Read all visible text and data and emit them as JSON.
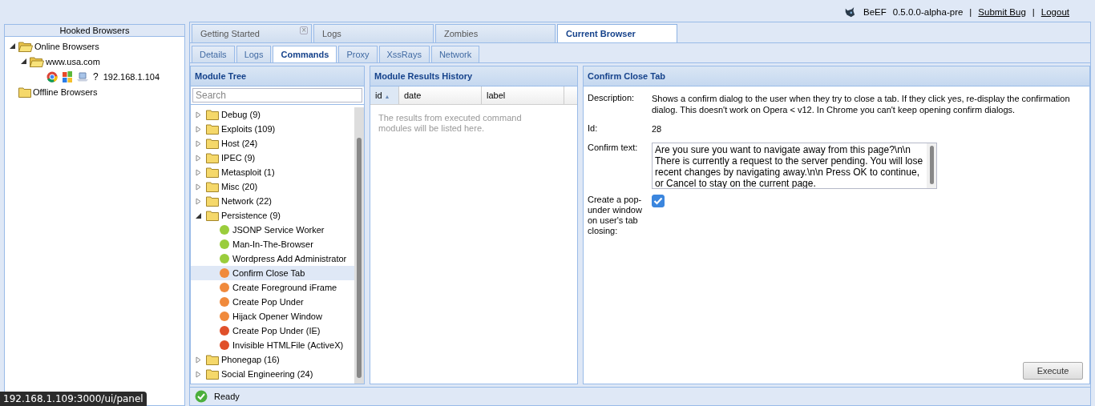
{
  "header": {
    "items": [
      {
        "kind": "text",
        "text": "BeEF"
      },
      {
        "kind": "text",
        "text": "0.5.0.0-alpha-pre"
      },
      {
        "kind": "sep",
        "text": "|"
      },
      {
        "kind": "link",
        "text": "Submit  Bug"
      },
      {
        "kind": "sep",
        "text": "|"
      },
      {
        "kind": "link",
        "text": "Logout"
      }
    ]
  },
  "hooked_browsers": {
    "title": "Hooked Browsers",
    "tree": [
      {
        "label": "Online Browsers",
        "expanded": true,
        "children": [
          {
            "label": "www.usa.com",
            "expanded": true,
            "children": [
              {
                "kind": "host",
                "label": "192.168.1.104",
                "os_unknown": "?"
              }
            ]
          }
        ]
      },
      {
        "label": "Offline Browsers",
        "expanded": false
      }
    ]
  },
  "main_tabs": [
    {
      "label": "Getting Started",
      "selected": false,
      "close_icon": "×"
    },
    {
      "label": "Logs",
      "selected": false
    },
    {
      "label": "Zombies",
      "selected": false
    },
    {
      "label": "Current Browser",
      "selected": true
    }
  ],
  "sub_tabs": [
    {
      "label": "Details",
      "selected": false
    },
    {
      "label": "Logs",
      "selected": false
    },
    {
      "label": "Commands",
      "selected": true
    },
    {
      "label": "Proxy",
      "selected": false
    },
    {
      "label": "XssRays",
      "selected": false
    },
    {
      "label": "Network",
      "selected": false
    }
  ],
  "module_tree": {
    "title": "Module Tree",
    "search": {
      "placeholder": "Search"
    },
    "items": [
      {
        "label": "Debug (9)",
        "expanded": false,
        "selected": false
      },
      {
        "label": "Exploits (109)",
        "expanded": false,
        "selected": false
      },
      {
        "label": "Host (24)",
        "expanded": false,
        "selected": false
      },
      {
        "label": "IPEC (9)",
        "expanded": false,
        "selected": false
      },
      {
        "label": "Metasploit (1)",
        "expanded": false,
        "selected": false
      },
      {
        "label": "Misc (20)",
        "expanded": false,
        "selected": false
      },
      {
        "label": "Network (22)",
        "expanded": false,
        "selected": false
      },
      {
        "label": "Persistence (9)",
        "expanded": true,
        "selected": false,
        "children": [
          {
            "label": "JSONP Service Worker",
            "color": "#9acd3c",
            "selected": false
          },
          {
            "label": "Man-In-The-Browser",
            "color": "#9acd3c",
            "selected": false
          },
          {
            "label": "Wordpress Add Administrator",
            "color": "#9acd3c",
            "selected": false
          },
          {
            "label": "Confirm Close Tab",
            "color": "#f08a3c",
            "selected": true
          },
          {
            "label": "Create Foreground iFrame",
            "color": "#f08a3c",
            "selected": false
          },
          {
            "label": "Create Pop Under",
            "color": "#f08a3c",
            "selected": false
          },
          {
            "label": "Hijack Opener Window",
            "color": "#f08a3c",
            "selected": false
          },
          {
            "label": "Create Pop Under (IE)",
            "color": "#e0502a",
            "selected": false
          },
          {
            "label": "Invisible HTMLFile (ActiveX)",
            "color": "#e0502a",
            "selected": false
          }
        ]
      },
      {
        "label": "Phonegap (16)",
        "expanded": false,
        "selected": false
      },
      {
        "label": "Social Engineering (24)",
        "expanded": false,
        "selected": false
      }
    ]
  },
  "results": {
    "title": "Module Results History",
    "columns": [
      {
        "label": "id",
        "sorted": true,
        "sort_icon": "▲"
      },
      {
        "label": "date",
        "sorted": false
      },
      {
        "label": "label",
        "sorted": false
      }
    ],
    "empty_text": "The results from executed command modules will be listed here."
  },
  "details": {
    "title": "Confirm Close Tab",
    "fields": [
      {
        "kind": "text",
        "label": "Description:",
        "value": "Shows a confirm dialog to the user when they try to close a tab. If they click yes, re-display the confirmation dialog. This doesn't work on Opera < v12. In Chrome you can't keep opening confirm dialogs."
      },
      {
        "kind": "text",
        "label": "Id:",
        "value": "28"
      },
      {
        "kind": "textarea",
        "label": "Confirm text:",
        "value": "Are you sure you want to navigate away from this page?\\n\\n There is currently a request to the server pending. You will lose recent changes by navigating away.\\n\\n Press OK to continue, or Cancel to stay on the current page."
      },
      {
        "kind": "checkbox",
        "label": "Create a pop-under window on user's tab closing:",
        "checked": true
      }
    ],
    "button": "Execute"
  },
  "status_bar": {
    "text": "Ready"
  },
  "link_preview": "192.168.1.109:3000/ui/panel"
}
